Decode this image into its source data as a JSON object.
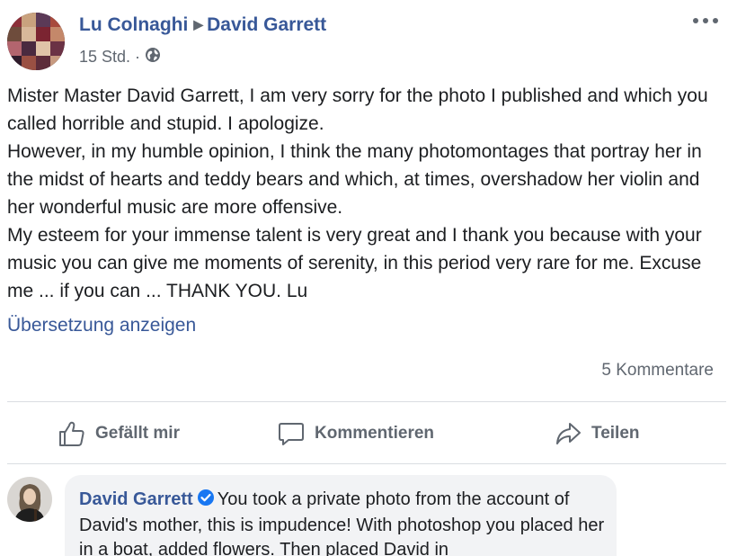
{
  "post": {
    "author": "Lu Colnaghi",
    "target": "David Garrett",
    "time": "15 Std.",
    "separator": "·",
    "text": "Mister Master David Garrett, I am very sorry for the photo I published and which you called horrible and stupid. I apologize.\nHowever, in my humble opinion, I think the many photomontages that portray her in the midst of hearts and teddy bears and which, at times, overshadow her violin and her wonderful music are more offensive.\nMy esteem for your immense talent is very great and I thank you because with your music you can give me moments of serenity, in this period very rare for me. Excuse me ... if you can ... THANK YOU. Lu",
    "translate_label": "Übersetzung anzeigen",
    "comments_count": "5 Kommentare"
  },
  "actions": {
    "like_label": "Gefällt mir",
    "comment_label": "Kommentieren",
    "share_label": "Teilen"
  },
  "comment": {
    "author": "David Garrett",
    "text": "You took a private photo from the account of David's mother, this is impudence! With photoshop you placed her in a boat, added flowers. Then placed David in"
  },
  "icons": {
    "audience": "globe-icon",
    "more": "more-options-icon",
    "like": "thumbs-up-icon",
    "comment": "speech-bubble-icon",
    "share": "share-arrow-icon",
    "verified": "verified-badge-icon"
  },
  "colors": {
    "link": "#385898",
    "muted": "#606770",
    "text": "#1c1e21",
    "bubble": "#f2f3f5",
    "verified": "#1877f2"
  }
}
